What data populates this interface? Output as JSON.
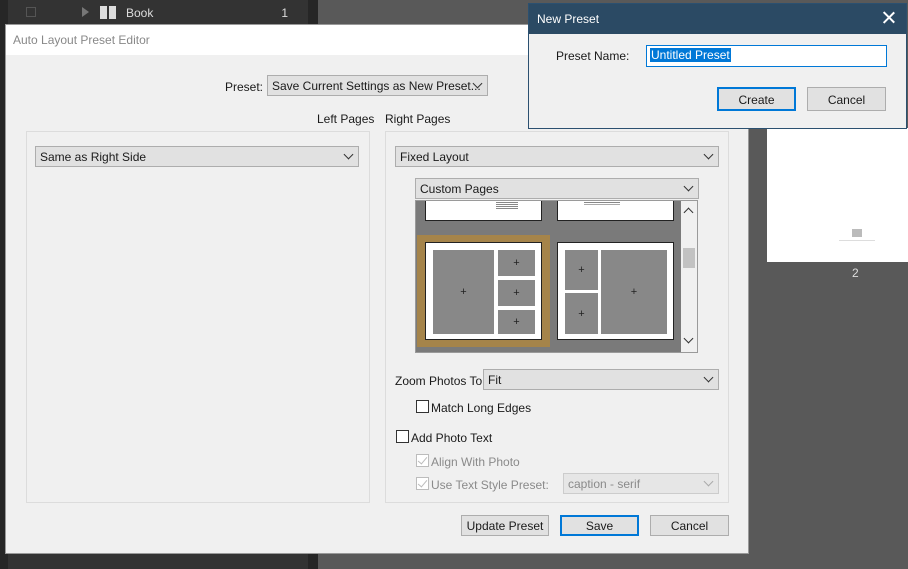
{
  "background": {
    "book_row": {
      "label": "Book",
      "count": "1"
    },
    "page_number": "2"
  },
  "editor": {
    "title": "Auto Layout Preset Editor",
    "preset_label": "Preset:",
    "preset_value": "Save Current Settings as New Preset...",
    "left_pages_label": "Left Pages",
    "right_pages_label": "Right Pages",
    "left_value": "Same as Right Side",
    "right_value": "Fixed Layout",
    "custom_pages_value": "Custom Pages",
    "zoom_label": "Zoom Photos To:",
    "zoom_value": "Fit",
    "match_long_edges": "Match Long Edges",
    "add_photo_text": "Add Photo Text",
    "align_with_photo": "Align With Photo",
    "use_text_style": "Use Text Style Preset:",
    "text_style_value": "caption - serif",
    "update_button": "Update Preset",
    "save_button": "Save",
    "cancel_button": "Cancel",
    "cell_marker": "+"
  },
  "new_preset": {
    "title": "New Preset",
    "name_label": "Preset Name:",
    "name_value": "Untitled Preset",
    "create_button": "Create",
    "cancel_button": "Cancel"
  },
  "colors": {
    "selection_frame": "#a5844a",
    "accent": "#0078d7",
    "title_bar": "#2b4a64"
  }
}
